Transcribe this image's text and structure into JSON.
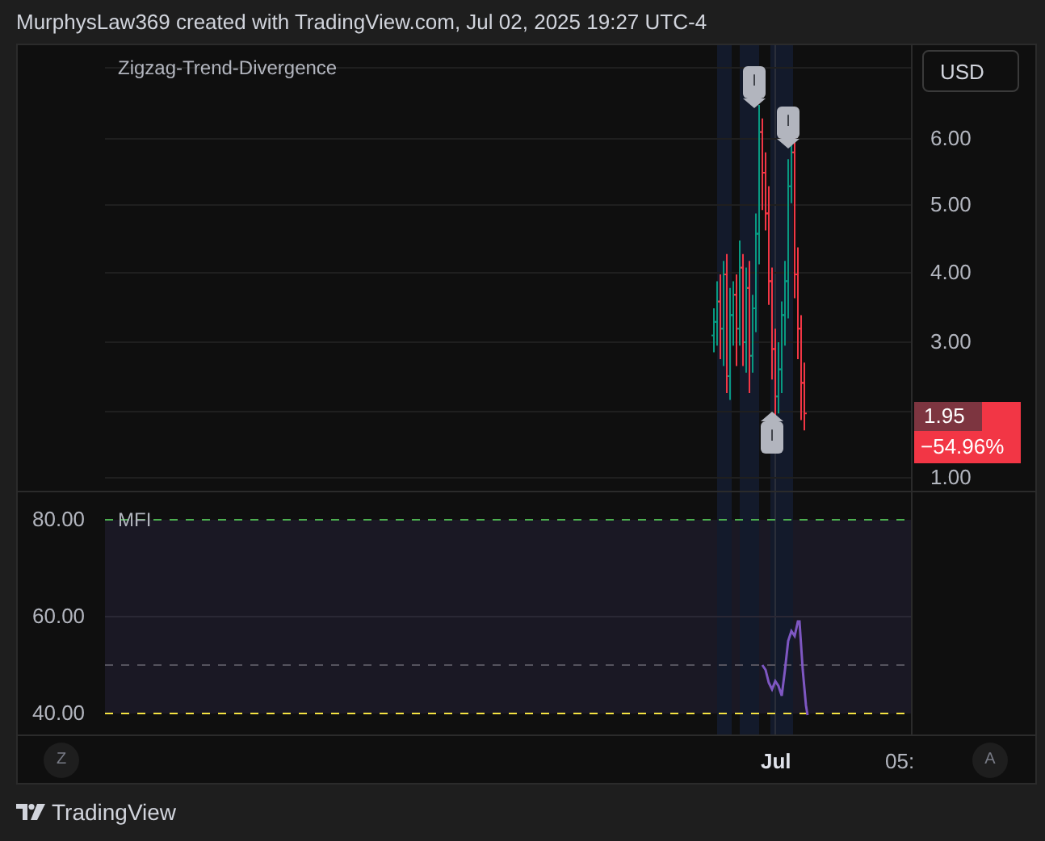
{
  "header": {
    "caption": "MurphysLaw369 created with TradingView.com, Jul 02, 2025 19:27 UTC-4"
  },
  "main_pane": {
    "indicator_label": "Zigzag-Trend-Divergence",
    "currency_button": "USD",
    "price_axis": [
      "6.00",
      "5.00",
      "4.00",
      "3.00",
      "1.00"
    ],
    "last_price": {
      "value": "1.95",
      "change": "−54.96%"
    },
    "pivot_markers": [
      {
        "text": "I",
        "kind": "high"
      },
      {
        "text": "I",
        "kind": "high"
      },
      {
        "text": "I",
        "kind": "low"
      }
    ]
  },
  "mfi_pane": {
    "label": "MFI",
    "axis": [
      "80.00",
      "60.00",
      "40.00"
    ]
  },
  "time_axis": {
    "left_button": "Z",
    "labels": [
      "Jul",
      "05:"
    ],
    "right_button": "A"
  },
  "footer": {
    "brand": "TradingView"
  }
}
